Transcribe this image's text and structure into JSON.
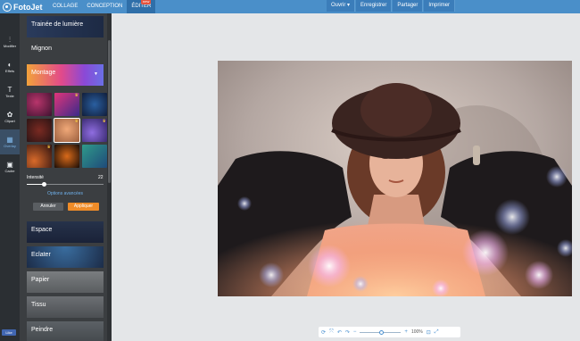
{
  "app": {
    "name": "FotoJet"
  },
  "topnav": {
    "items": [
      {
        "label": "COLLAGE"
      },
      {
        "label": "CONCEPTION"
      },
      {
        "label": "ÉDITER"
      }
    ],
    "new_badge": "new"
  },
  "actions": {
    "open": "Ouvrir ▾",
    "save": "Enregistrer",
    "share": "Partager",
    "print": "Imprimer"
  },
  "tools": [
    {
      "label": "Modifier",
      "icon": "sliders-icon"
    },
    {
      "label": "Effets",
      "icon": "effects-icon"
    },
    {
      "label": "Texte",
      "icon": "text-icon"
    },
    {
      "label": "Clipart",
      "icon": "clipart-icon"
    },
    {
      "label": "Overlay",
      "icon": "overlay-icon"
    },
    {
      "label": "Cadre",
      "icon": "frame-icon"
    }
  ],
  "panel": {
    "categories_top": [
      "Trainée de lumière",
      "Mignon"
    ],
    "selected_category": "Montage",
    "intensity_label": "Intensité",
    "intensity_value": "22",
    "advanced_options": "Options avancées",
    "cancel": "Annuler",
    "apply": "Appliquer",
    "categories_bottom": [
      "Espace",
      "Eclater",
      "Papier",
      "Tissu",
      "Peindre"
    ]
  },
  "facebook": {
    "like": "Like"
  },
  "bottom_toolbar": {
    "zoom": "100%"
  },
  "colors": {
    "topbar": "#4a8fc9",
    "accent_orange": "#ef8c28",
    "link_blue": "#6fb0ea"
  }
}
